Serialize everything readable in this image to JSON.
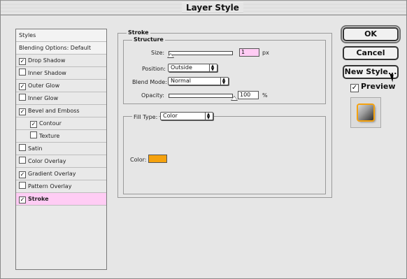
{
  "window": {
    "title": "Layer Style"
  },
  "styles_list": {
    "header": "Styles",
    "blending": "Blending Options: Default",
    "items": [
      {
        "label": "Drop Shadow",
        "checked": true
      },
      {
        "label": "Inner Shadow",
        "checked": false
      },
      {
        "label": "Outer Glow",
        "checked": true
      },
      {
        "label": "Inner Glow",
        "checked": false
      },
      {
        "label": "Bevel and Emboss",
        "checked": true
      },
      {
        "label": "Contour",
        "checked": true
      },
      {
        "label": "Texture",
        "checked": false
      },
      {
        "label": "Satin",
        "checked": false
      },
      {
        "label": "Color Overlay",
        "checked": false
      },
      {
        "label": "Gradient Overlay",
        "checked": true
      },
      {
        "label": "Pattern Overlay",
        "checked": false
      },
      {
        "label": "Stroke",
        "checked": true
      }
    ],
    "selected": "Stroke"
  },
  "stroke": {
    "group_title": "Stroke",
    "structure_title": "Structure",
    "size_label": "Size:",
    "size_value": "1",
    "size_unit": "px",
    "position_label": "Position:",
    "position_value": "Outside",
    "blend_label": "Blend Mode:",
    "blend_value": "Normal",
    "opacity_label": "Opacity:",
    "opacity_value": "100",
    "opacity_unit": "%",
    "fill_type_label": "Fill Type:",
    "fill_type_value": "Color",
    "color_label": "Color:",
    "stroke_color": "#f5a20e"
  },
  "buttons": {
    "ok": "OK",
    "cancel": "Cancel",
    "new_style": "New Style...",
    "preview_label": "Preview",
    "preview_checked": true
  },
  "colors": {
    "selected_row": "#ffccf4",
    "size_field": "#ffccf4",
    "stroke_color": "#f5a20e"
  },
  "icons": [
    "checkbox-icon",
    "popup-arrow-icon",
    "slider-thumb-icon",
    "cursor-arrow-icon"
  ]
}
